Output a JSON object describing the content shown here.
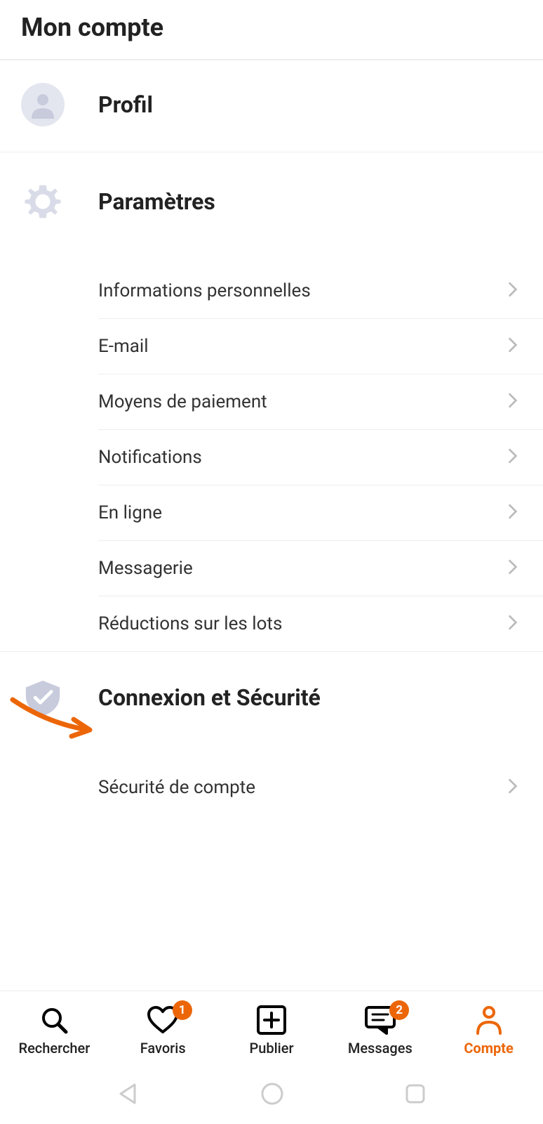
{
  "header": {
    "title": "Mon compte"
  },
  "profile": {
    "title": "Profil"
  },
  "settings": {
    "title": "Paramètres",
    "items": [
      {
        "label": "Informations personnelles"
      },
      {
        "label": "E-mail"
      },
      {
        "label": "Moyens de paiement"
      },
      {
        "label": "Notifications"
      },
      {
        "label": "En ligne"
      },
      {
        "label": "Messagerie"
      },
      {
        "label": "Réductions sur les lots"
      }
    ]
  },
  "security": {
    "title": "Connexion et Sécurité",
    "items": [
      {
        "label": "Sécurité de compte"
      }
    ]
  },
  "nav": {
    "items": [
      {
        "label": "Rechercher",
        "icon": "search",
        "badge": null,
        "active": false
      },
      {
        "label": "Favoris",
        "icon": "heart",
        "badge": "1",
        "active": false
      },
      {
        "label": "Publier",
        "icon": "plus-box",
        "badge": null,
        "active": false
      },
      {
        "label": "Messages",
        "icon": "message",
        "badge": "2",
        "active": false
      },
      {
        "label": "Compte",
        "icon": "person",
        "badge": null,
        "active": true
      }
    ]
  },
  "annotation": {
    "arrow_points_to": "Réductions sur les lots"
  },
  "colors": {
    "accent": "#ec6608"
  }
}
